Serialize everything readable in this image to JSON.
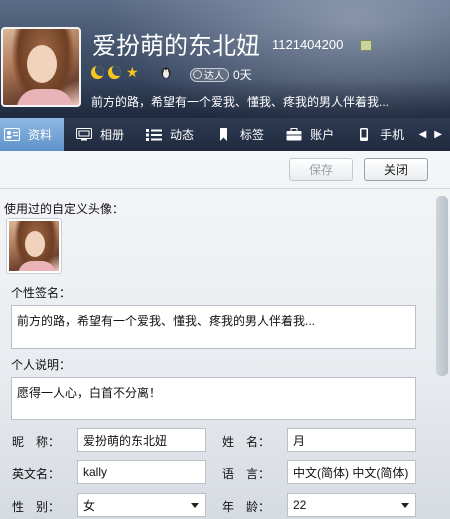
{
  "header": {
    "nickname": "爱扮萌的东北妞",
    "qq_number": "1121404200",
    "signature": "前方的路，希望有一个爱我、懂我、疼我的男人伴着我...",
    "daren_badge": "达人",
    "daren_days": "0天"
  },
  "tabs": [
    {
      "label": "资料",
      "icon": "profile-card-icon",
      "active": true
    },
    {
      "label": "相册",
      "icon": "album-icon",
      "active": false
    },
    {
      "label": "动态",
      "icon": "feed-list-icon",
      "active": false
    },
    {
      "label": "标签",
      "icon": "bookmark-tag-icon",
      "active": false
    },
    {
      "label": "账户",
      "icon": "briefcase-account-icon",
      "active": false
    },
    {
      "label": "手机",
      "icon": "mobile-phone-icon",
      "active": false
    }
  ],
  "toolbar": {
    "save_label": "保存",
    "close_label": "关闭"
  },
  "form": {
    "used_avatars_label": "使用过的自定义头像：",
    "signature_label": "个性签名：",
    "signature_value": "前方的路，希望有一个爱我、懂我、疼我的男人伴着我...",
    "description_label": "个人说明：",
    "description_value": "愿得一人心，白首不分离！",
    "nickname_label": "昵　称：",
    "nickname_value": "爱扮萌的东北妞",
    "surname_label": "姓　名：",
    "surname_value": "月",
    "english_name_label": "英文名：",
    "english_name_value": "kally",
    "language_label": "语　言：",
    "language_value": "中文(简体)  中文(简体)",
    "gender_label": "性　别：",
    "gender_value": "女",
    "age_label": "年　龄：",
    "age_value": "22"
  },
  "colors": {
    "tab_active": "#6fa0d4",
    "tab_bar": "#26324a",
    "header_bg": "#3f4f68"
  }
}
